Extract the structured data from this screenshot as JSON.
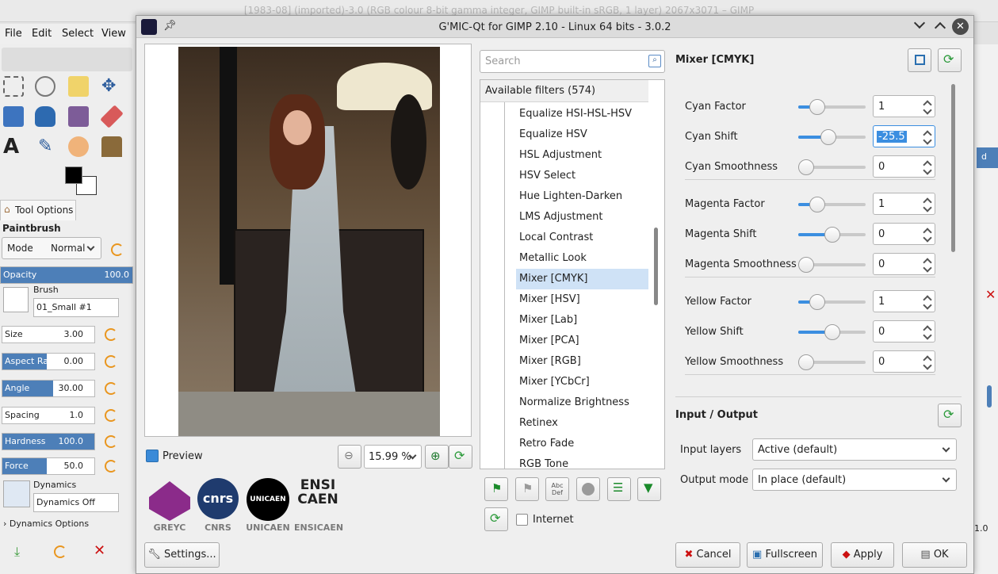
{
  "gimp": {
    "title": "[1983-08] (imported)-3.0 (RGB colour 8-bit gamma integer, GIMP built-in sRGB, 1 layer) 2067x3071 – GIMP",
    "menu": [
      "File",
      "Edit",
      "Select",
      "View"
    ],
    "tool_options_tab": "Tool Options",
    "tool_name": "Paintbrush",
    "mode_label": "Mode",
    "mode_value": "Normal",
    "opacity_label": "Opacity",
    "opacity_value": "100.0",
    "brush_label": "Brush",
    "brush_value": "01_Small #1",
    "size_label": "Size",
    "size_value": "3.00",
    "aspect_label": "Aspect Ratio",
    "aspect_value": "0.00",
    "angle_label": "Angle",
    "angle_value": "30.00",
    "spacing_label": "Spacing",
    "spacing_value": "1.0",
    "hardness_label": "Hardness",
    "hardness_value": "100.0",
    "force_label": "Force",
    "force_value": "50.0",
    "dynamics_label": "Dynamics",
    "dynamics_value": "Dynamics Off",
    "dynamics_options": "Dynamics Options",
    "right_value": "1.0",
    "right_text": "d"
  },
  "dialog": {
    "title": "G'MIC-Qt for GIMP 2.10 - Linux 64 bits - 3.0.2",
    "preview_label": "Preview",
    "zoom_value": "15.99 %",
    "settings_label": "Settings...",
    "internet_label": "Internet",
    "search_placeholder": "Search",
    "filters_header": "Available filters (574)",
    "filters": [
      "Equalize HSI-HSL-HSV",
      "Equalize HSV",
      "HSL Adjustment",
      "HSV Select",
      "Hue Lighten-Darken",
      "LMS Adjustment",
      "Local Contrast",
      "Metallic Look",
      "Mixer [CMYK]",
      "Mixer [HSV]",
      "Mixer [Lab]",
      "Mixer [PCA]",
      "Mixer [RGB]",
      "Mixer [YCbCr]",
      "Normalize Brightness",
      "Retinex",
      "Retro Fade",
      "RGB Tone"
    ],
    "selected_filter": "Mixer [CMYK]",
    "filter_title": "Mixer [CMYK]",
    "params": [
      {
        "label": "Cyan Factor",
        "value": "1",
        "level": 0.28
      },
      {
        "label": "Cyan Shift",
        "value": "-25.5",
        "level": 0.45
      },
      {
        "label": "Cyan Smoothness",
        "value": "0",
        "level": 0.0
      },
      {
        "label": "Magenta Factor",
        "value": "1",
        "level": 0.28
      },
      {
        "label": "Magenta Shift",
        "value": "0",
        "level": 0.5
      },
      {
        "label": "Magenta Smoothness",
        "value": "0",
        "level": 0.0
      },
      {
        "label": "Yellow Factor",
        "value": "1",
        "level": 0.28
      },
      {
        "label": "Yellow Shift",
        "value": "0",
        "level": 0.5
      },
      {
        "label": "Yellow Smoothness",
        "value": "0",
        "level": 0.0
      }
    ],
    "io_title": "Input / Output",
    "input_layers_label": "Input layers",
    "input_layers_value": "Active (default)",
    "output_mode_label": "Output mode",
    "output_mode_value": "In place (default)",
    "cancel": "Cancel",
    "fullscreen": "Fullscreen",
    "apply": "Apply",
    "ok": "OK",
    "logos": [
      "GREYC",
      "CNRS",
      "UNICAEN",
      "ENSICAEN"
    ],
    "logo_texts": [
      "cnrs",
      "UNICAEN",
      "ENSI",
      "CAEN"
    ],
    "abc_icon": "Abc Def"
  }
}
